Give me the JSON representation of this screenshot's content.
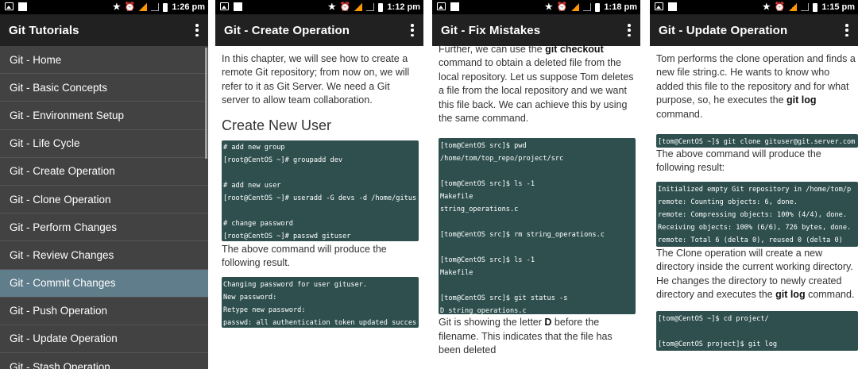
{
  "screens": [
    {
      "status_time": "1:26 pm",
      "title": "Git Tutorials",
      "nav_items": [
        "Git - Home",
        "Git - Basic Concepts",
        "Git - Environment Setup",
        "Git - Life Cycle",
        "Git - Create Operation",
        "Git - Clone Operation",
        "Git - Perform Changes",
        "Git - Review Changes",
        "Git - Commit Changes",
        "Git - Push Operation",
        "Git - Update Operation",
        "Git - Stash Operation"
      ],
      "active_index": 8
    },
    {
      "status_time": "1:12 pm",
      "title": "Git - Create Operation",
      "intro": "In this chapter, we will see how to create a remote Git repository; from now on, we will refer to it as Git Server. We need a Git server to allow team collaboration.",
      "heading": "Create New User",
      "code1": "# add new group\n[root@CentOS ~]# groupadd dev\n\n# add new user\n[root@CentOS ~]# useradd -G devs -d /home/gitus\n\n# change password\n[root@CentOS ~]# passwd gituser",
      "after": "The above command will produce the following result.",
      "code2": "Changing password for user gituser.\nNew password:\nRetype new password:\npasswd: all authentication token updated succes"
    },
    {
      "status_time": "1:18 pm",
      "title": "Git - Fix Mistakes",
      "p1_a": "Further, we can use the ",
      "p1_b": "git checkout",
      "p1_c": " command to obtain a deleted file from the local repository. Let us suppose Tom deletes a file from the local repository and we want this file back. We can achieve this by using the same command.",
      "code": "[tom@CentOS src]$ pwd\n/home/tom/top_repo/project/src\n\n[tom@CentOS src]$ ls -1\nMakefile\nstring_operations.c\n\n[tom@CentOS src]$ rm string_operations.c\n\n[tom@CentOS src]$ ls -1\nMakefile\n\n[tom@CentOS src]$ git status -s\nD string_operations.c",
      "p2_a": "Git is showing the letter ",
      "p2_b": "D",
      "p2_c": " before the filename. This indicates that the file has been deleted"
    },
    {
      "status_time": "1:15 pm",
      "title": "Git - Update Operation",
      "p1_a": "Tom performs the clone operation and finds a new file string.c. He wants to know who added this file to the repository and for what purpose, so, he executes the ",
      "p1_b": "git log",
      "p1_c": " command.",
      "code1": "[tom@CentOS ~]$ git clone gituser@git.server.com",
      "p2": "The above command will produce the following result:",
      "code2": "Initialized empty Git repository in /home/tom/p\nremote: Counting objects: 6, done.\nremote: Compressing objects: 100% (4/4), done.\nReceiving objects: 100% (6/6), 726 bytes, done.\nremote: Total 6 (delta 0), reused 0 (delta 0)",
      "p3_a": "The Clone operation will create a new directory inside the current working directory. He changes the directory to newly created directory and executes the ",
      "p3_b": "git log",
      "p3_c": " command.",
      "code3": "[tom@CentOS ~]$ cd project/\n\n[tom@CentOS project]$ git log"
    }
  ]
}
